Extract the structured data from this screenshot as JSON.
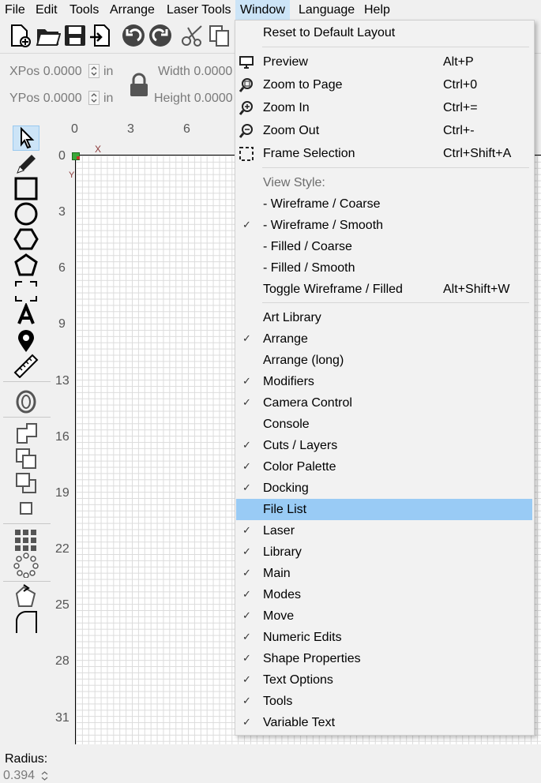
{
  "menubar": {
    "items": [
      {
        "label": "File"
      },
      {
        "label": "Edit"
      },
      {
        "label": "Tools"
      },
      {
        "label": "Arrange"
      },
      {
        "label": "Laser Tools"
      },
      {
        "label": "Window"
      },
      {
        "label": "Language"
      },
      {
        "label": "Help"
      }
    ]
  },
  "toolbar": {
    "icons": [
      "new-file-icon",
      "open-folder-icon",
      "save-icon",
      "import-icon",
      "undo-icon",
      "redo-icon",
      "cut-icon",
      "copy-icon"
    ]
  },
  "numeric": {
    "xpos_label": "XPos 0.0000",
    "ypos_label": "YPos 0.0000",
    "unit_x": "in",
    "unit_y": "in",
    "width_label": "Width 0.0000",
    "height_label": "Height 0.0000"
  },
  "tools": {
    "radius_label": "Radius:",
    "radius_value": "0.394"
  },
  "rulers": {
    "top": [
      "0",
      "3",
      "6"
    ],
    "left": [
      "0",
      "3",
      "6",
      "9",
      "13",
      "16",
      "19",
      "22",
      "25",
      "28",
      "31"
    ],
    "x_axis_label": "X",
    "y_axis_label": "Y"
  },
  "window_menu": {
    "reset": "Reset to Default Layout",
    "preview": {
      "label": "Preview",
      "shortcut": "Alt+P"
    },
    "zoom_page": {
      "label": "Zoom to Page",
      "shortcut": "Ctrl+0"
    },
    "zoom_in": {
      "label": "Zoom In",
      "shortcut": "Ctrl+="
    },
    "zoom_out": {
      "label": "Zoom Out",
      "shortcut": "Ctrl+-"
    },
    "frame_sel": {
      "label": "Frame Selection",
      "shortcut": "Ctrl+Shift+A"
    },
    "view_style": "View Style:",
    "wire_coarse": "-  Wireframe / Coarse",
    "wire_smooth": "-  Wireframe / Smooth",
    "fill_coarse": "-  Filled / Coarse",
    "fill_smooth": "-  Filled / Smooth",
    "toggle": {
      "label": "Toggle Wireframe / Filled",
      "shortcut": "Alt+Shift+W"
    },
    "check_mark": "✓",
    "panels": [
      {
        "label": "Art Library",
        "checked": false
      },
      {
        "label": "Arrange",
        "checked": true
      },
      {
        "label": "Arrange (long)",
        "checked": false
      },
      {
        "label": "Modifiers",
        "checked": true
      },
      {
        "label": "Camera Control",
        "checked": true
      },
      {
        "label": "Console",
        "checked": false
      },
      {
        "label": "Cuts / Layers",
        "checked": true
      },
      {
        "label": "Color Palette",
        "checked": true
      },
      {
        "label": "Docking",
        "checked": true
      },
      {
        "label": "File List",
        "checked": false,
        "highlighted": true
      },
      {
        "label": "Laser",
        "checked": true
      },
      {
        "label": "Library",
        "checked": true
      },
      {
        "label": "Main",
        "checked": true
      },
      {
        "label": "Modes",
        "checked": true
      },
      {
        "label": "Move",
        "checked": true
      },
      {
        "label": "Numeric Edits",
        "checked": true
      },
      {
        "label": "Shape Properties",
        "checked": true
      },
      {
        "label": "Text Options",
        "checked": true
      },
      {
        "label": "Tools",
        "checked": true
      },
      {
        "label": "Variable Text",
        "checked": true
      }
    ]
  },
  "colors": {
    "highlight": "#99cbf5",
    "menu_open": "#cce4f7",
    "origin_green": "#3aa83a",
    "origin_red": "#c0392b"
  }
}
